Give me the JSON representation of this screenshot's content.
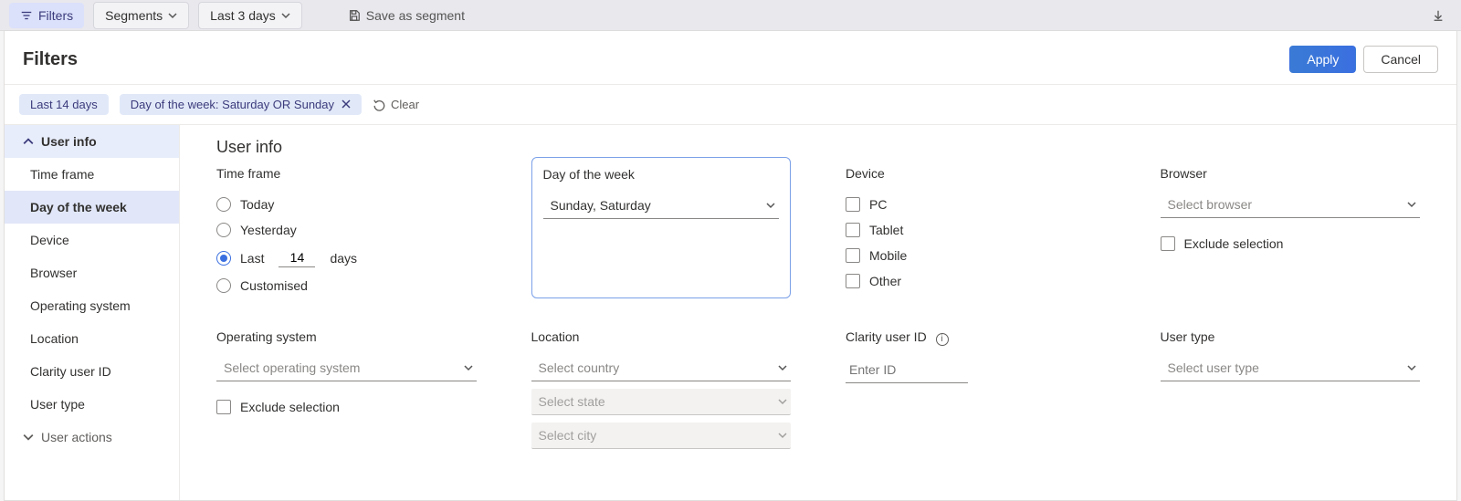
{
  "toolbar": {
    "filters": "Filters",
    "segments": "Segments",
    "last3": "Last 3 days",
    "saveSegment": "Save as segment"
  },
  "modal": {
    "title": "Filters",
    "apply": "Apply",
    "cancel": "Cancel"
  },
  "chips": {
    "chip1": "Last 14 days",
    "chip2": "Day of the week: Saturday OR Sunday",
    "clear": "Clear"
  },
  "sidebar": {
    "userInfo": "User info",
    "items": {
      "timeFrame": "Time frame",
      "dayOfWeek": "Day of the week",
      "device": "Device",
      "browser": "Browser",
      "os": "Operating system",
      "location": "Location",
      "clarityId": "Clarity user ID",
      "userType": "User type"
    },
    "userActions": "User actions"
  },
  "content": {
    "heading": "User info",
    "timeFrame": {
      "label": "Time frame",
      "today": "Today",
      "yesterday": "Yesterday",
      "lastPrefix": "Last",
      "lastValue": "14",
      "lastSuffix": "days",
      "customised": "Customised"
    },
    "dayOfWeek": {
      "label": "Day of the week",
      "value": "Sunday, Saturday"
    },
    "device": {
      "label": "Device",
      "pc": "PC",
      "tablet": "Tablet",
      "mobile": "Mobile",
      "other": "Other"
    },
    "browser": {
      "label": "Browser",
      "placeholder": "Select browser",
      "exclude": "Exclude selection"
    },
    "os": {
      "label": "Operating system",
      "placeholder": "Select operating system",
      "exclude": "Exclude selection"
    },
    "location": {
      "label": "Location",
      "country": "Select country",
      "state": "Select state",
      "city": "Select city"
    },
    "clarityId": {
      "label": "Clarity user ID",
      "placeholder": "Enter ID"
    },
    "userType": {
      "label": "User type",
      "placeholder": "Select user type"
    }
  }
}
